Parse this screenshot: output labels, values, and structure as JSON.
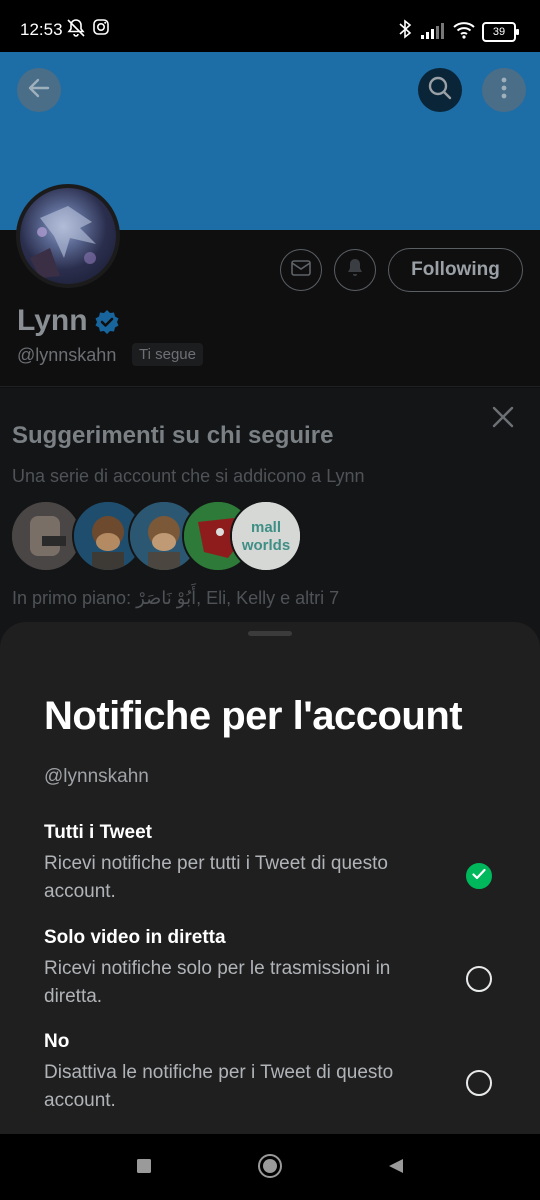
{
  "status_bar": {
    "time": "12:53",
    "battery": "39",
    "icons": [
      "bell-off-icon",
      "instagram-icon",
      "bluetooth-icon",
      "signal-icon",
      "wifi-icon",
      "battery-icon"
    ]
  },
  "profile": {
    "name": "Lynn",
    "handle": "@lynnskahn",
    "follows_you": "Ti segue",
    "follow_button": "Following",
    "verified_color": "#1d9bf0",
    "banner_color": "#1d6da6"
  },
  "suggestions": {
    "title": "Suggerimenti su chi seguire",
    "subtitle": "Una serie di account che si addicono a Lynn",
    "featured": "In primo piano: أَبُوْ نَاصَرْ, Eli, Kelly e altri 7",
    "avatar_texts": [
      "mall worlds"
    ]
  },
  "sheet": {
    "title": "Notifiche per l'account",
    "handle": "@lynnskahn",
    "options": [
      {
        "title": "Tutti i Tweet",
        "desc": "Ricevi notifiche per tutti i Tweet di questo account.",
        "selected": true
      },
      {
        "title": "Solo video in diretta",
        "desc": "Ricevi notifiche solo per le trasmissioni in diretta.",
        "selected": false
      },
      {
        "title": "No",
        "desc": "Disattiva le notifiche per i Tweet di questo account.",
        "selected": false
      }
    ],
    "accent": "#00b85c"
  }
}
